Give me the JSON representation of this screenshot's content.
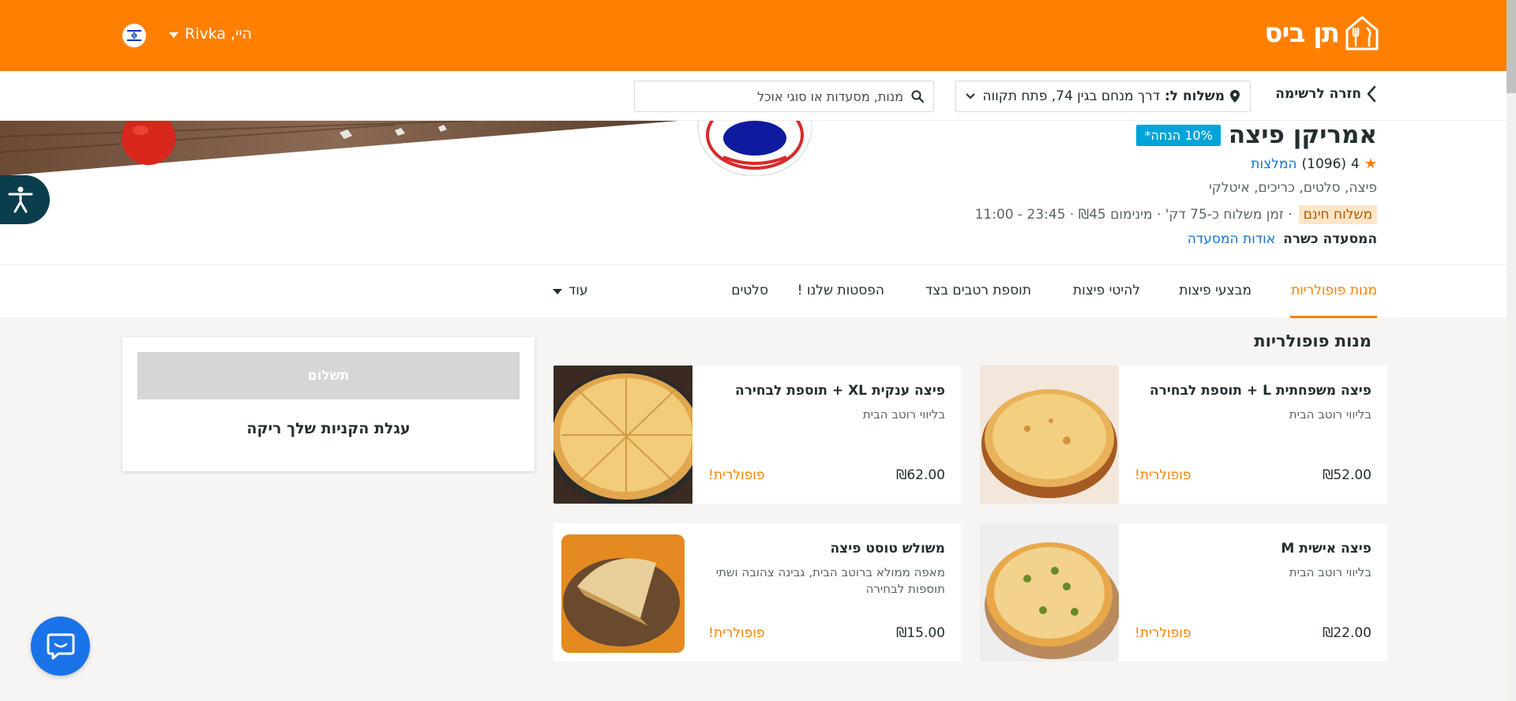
{
  "header": {
    "logo_text": "תן ביס",
    "greeting": "היי, Rivka",
    "brand_color": "#ff8000"
  },
  "subheader": {
    "back_label": "חזרה לרשימה",
    "deliver_label": "משלוח ל:",
    "deliver_address": "דרך מנחם בגין 74, פתח תקווה",
    "search_placeholder": "מנות, מסעדות או סוגי אוכל"
  },
  "restaurant": {
    "name": "אמריקן פיצה",
    "discount": "10% הנחה*",
    "rating": "4",
    "reviews_count": "(1096)",
    "reviews_label": "המלצות",
    "cuisines": "פיצה, סלטים, כריכים, איטלקי",
    "free_delivery": "משלוח חינם",
    "meta": "· זמן משלוח כ-75 דק' · מינימום ₪45 · 23:45 - 11:00",
    "kosher": "המסעדה כשרה",
    "about_label": "אודות המסעדה"
  },
  "tabs": [
    {
      "label": "מנות פופולריות"
    },
    {
      "label": "מבצעי פיצות"
    },
    {
      "label": "להיטי פיצות"
    },
    {
      "label": "תוספת רטבים בצד"
    },
    {
      "label": "הפסטות שלנו !"
    },
    {
      "label": "סלטים"
    }
  ],
  "more_label": "עוד",
  "section_title": "מנות פופולריות",
  "dishes": [
    {
      "title": "פיצה משפחתית L + תוספת לבחירה",
      "desc": "בליווי רוטב הבית",
      "price": "₪52.00",
      "badge": "פופולרית!"
    },
    {
      "title": "פיצה ענקית XL + תוספת לבחירה",
      "desc": "בליווי רוטב הבית",
      "price": "₪62.00",
      "badge": "פופולרית!"
    },
    {
      "title": "פיצה אישית M",
      "desc": "בליווי רוטב הבית",
      "price": "₪22.00",
      "badge": "פופולרית!"
    },
    {
      "title": "משולש טוסט פיצה",
      "desc": "מאפה ממולא ברוטב הבית, גבינה צהובה ושתי תוספות לבחירה",
      "price": "₪15.00",
      "badge": "פופולרית!"
    }
  ],
  "cart": {
    "checkout_label": "תשלום",
    "empty_text": "עגלת הקניות שלך ריקה"
  }
}
